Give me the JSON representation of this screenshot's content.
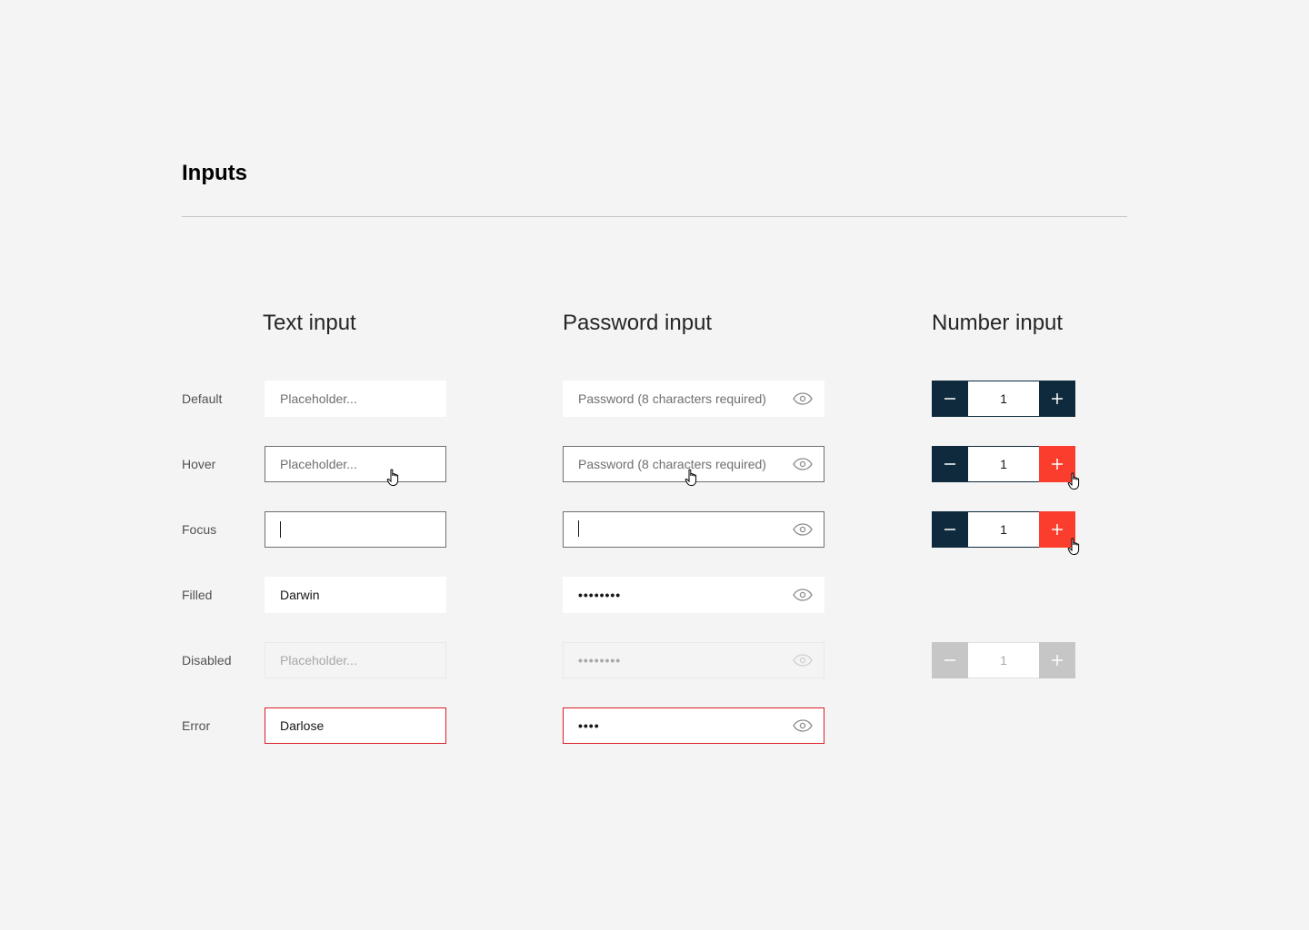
{
  "page": {
    "title": "Inputs"
  },
  "columns": {
    "text": "Text input",
    "password": "Password input",
    "number": "Number input"
  },
  "rows": {
    "default": "Default",
    "hover": "Hover",
    "focus": "Focus",
    "filled": "Filled",
    "disabled": "Disabled",
    "error": "Error"
  },
  "text_input": {
    "placeholder": "Placeholder...",
    "filled_value": "Darwin",
    "error_value": "Darlose"
  },
  "password_input": {
    "placeholder": "Password (8 characters required)",
    "filled_mask": "••••••••",
    "disabled_mask": "••••••••",
    "error_mask": "••••"
  },
  "number_input": {
    "value": "1"
  },
  "icons": {
    "eye": "eye-icon",
    "minus": "minus-icon",
    "plus": "plus-icon",
    "pointer": "hand-pointer-cursor-icon"
  },
  "colors": {
    "stepper_dark": "#0f2a3d",
    "stepper_hover": "#fa3d2c",
    "error_border": "#da1e28",
    "disabled_bg": "#c6c6c6"
  }
}
